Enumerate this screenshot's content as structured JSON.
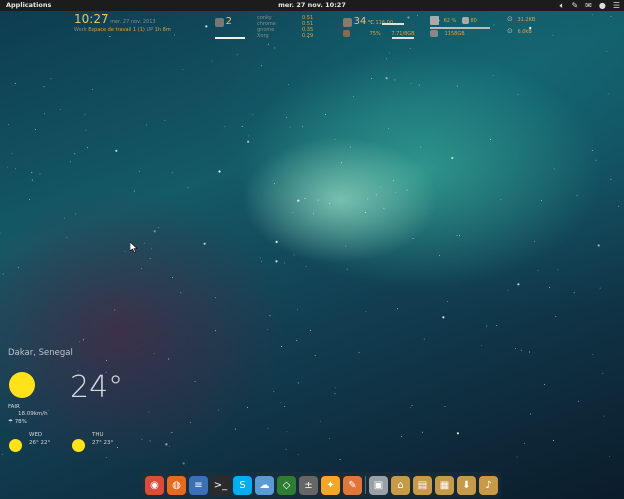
{
  "topbar": {
    "applications": "Applications",
    "clock": "mer. 27 nov. 10:27",
    "tray_icons": [
      "volume-icon",
      "pen-icon",
      "mail-icon",
      "user-icon",
      "menu-icon"
    ]
  },
  "conky": {
    "time": "10:27",
    "date": "mer. 27 nov. 2013",
    "workspace_label": "Work",
    "workspace": "Espace de travail 1 (1)",
    "uptime_label": "UP",
    "uptime": "1h 8m",
    "cpu_count": "2",
    "procs": [
      {
        "name": "conky",
        "value": "0.51"
      },
      {
        "name": "chrome",
        "value": "0.51"
      },
      {
        "name": "gnome",
        "value": "0.35"
      },
      {
        "name": "Xorg",
        "value": "0.29"
      }
    ],
    "temp": "34",
    "temp_unit": "°C",
    "temp_max": "116.00",
    "vol": "75%",
    "mem": "7.71/8GB",
    "disk1": "62 %",
    "disk2": "80",
    "disk_extra": "1158GB",
    "net_down": "31.2KB",
    "net_up": "6.0kB"
  },
  "weather": {
    "location": "Dakar, Senegal",
    "temperature": "24°",
    "condition": "FAIR",
    "wind": "18.09km/h",
    "humidity": "78%",
    "forecast": [
      {
        "day": "WED",
        "hi": "26°",
        "lo": "22°"
      },
      {
        "day": "THU",
        "hi": "27°",
        "lo": "23°"
      }
    ]
  },
  "dock": {
    "apps": [
      {
        "name": "chrome",
        "color": "#dd4b39",
        "glyph": "◉"
      },
      {
        "name": "firefox",
        "color": "#e66a1f",
        "glyph": "◍"
      },
      {
        "name": "text-editor",
        "color": "#3b6fb6",
        "glyph": "≡"
      },
      {
        "name": "terminal",
        "color": "#2b2b2b",
        "glyph": ">_"
      },
      {
        "name": "skype",
        "color": "#00aff0",
        "glyph": "S"
      },
      {
        "name": "cloud",
        "color": "#5a9bd5",
        "glyph": "☁"
      },
      {
        "name": "shell",
        "color": "#2e7d32",
        "glyph": "◇"
      },
      {
        "name": "calculator",
        "color": "#666666",
        "glyph": "±"
      },
      {
        "name": "graphics",
        "color": "#f5a623",
        "glyph": "✦"
      },
      {
        "name": "paint",
        "color": "#e0763a",
        "glyph": "✎"
      },
      {
        "name": "files",
        "color": "#9aa0a6",
        "glyph": "▣"
      },
      {
        "name": "folder-home",
        "color": "#c79a4a",
        "glyph": "⌂"
      },
      {
        "name": "folder-docs",
        "color": "#c79a4a",
        "glyph": "▤"
      },
      {
        "name": "folder-pics",
        "color": "#c79a4a",
        "glyph": "▦"
      },
      {
        "name": "folder-downloads",
        "color": "#c79a4a",
        "glyph": "⬇"
      },
      {
        "name": "folder-music",
        "color": "#c79a4a",
        "glyph": "♪"
      }
    ]
  }
}
